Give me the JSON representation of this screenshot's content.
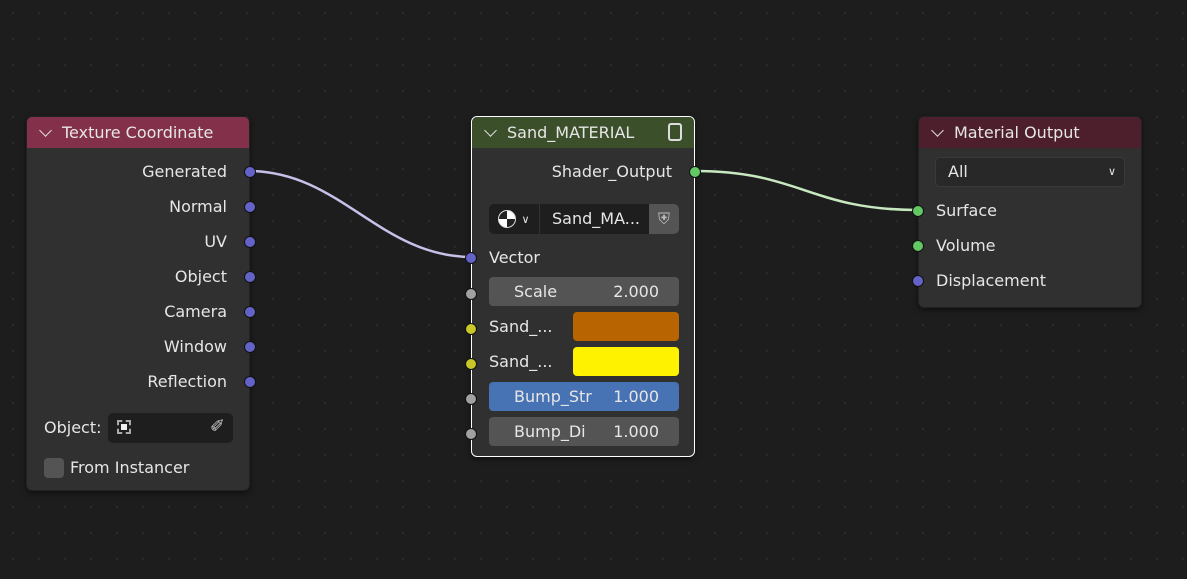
{
  "colors": {
    "vector": "#6363c7",
    "float": "#a1a1a1",
    "color": "#c7c729",
    "shader": "#63c763",
    "tex_header": "#83304a",
    "group_header": "#3c4f2b",
    "output_header": "#4d1e2b",
    "accent_blue": "#4772b3",
    "sand1": "#b86400",
    "sand2": "#fff200"
  },
  "texture_coordinate": {
    "title": "Texture Coordinate",
    "outputs": [
      "Generated",
      "Normal",
      "UV",
      "Object",
      "Camera",
      "Window",
      "Reflection"
    ],
    "object_label": "Object:",
    "from_instancer": "From Instancer"
  },
  "group": {
    "title": "Sand_MATERIAL",
    "output": "Shader_Output",
    "datablock": "Sand_MA...",
    "vector": "Vector",
    "inputs": [
      {
        "label": "Scale",
        "value": "2.000"
      },
      {
        "label": "Sand_..."
      },
      {
        "label": "Sand_..."
      },
      {
        "label": "Bump_Str",
        "value": "1.000"
      },
      {
        "label": "Bump_Di",
        "value": "1.000"
      }
    ]
  },
  "material_output": {
    "title": "Material Output",
    "target": "All",
    "inputs": [
      "Surface",
      "Volume",
      "Displacement"
    ]
  }
}
